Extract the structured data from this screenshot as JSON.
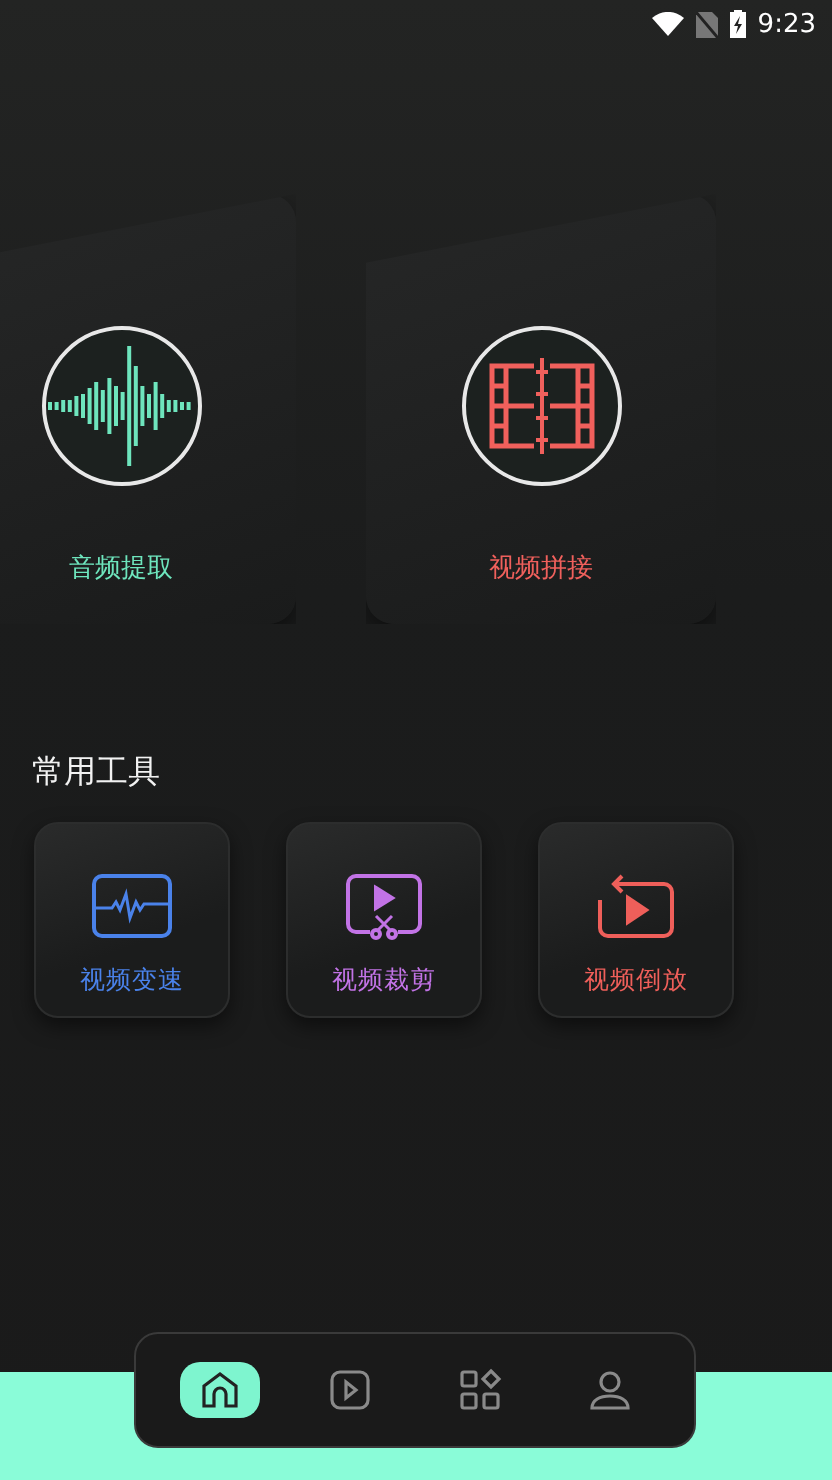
{
  "status_bar": {
    "time": "9:23"
  },
  "feature_cards": [
    {
      "kind": "audio",
      "label": "音频提取"
    },
    {
      "kind": "splice",
      "label": "视频拼接"
    }
  ],
  "section_title": "常用工具",
  "tools": [
    {
      "kind": "speed",
      "label": "视频变速"
    },
    {
      "kind": "cut",
      "label": "视频裁剪"
    },
    {
      "kind": "reverse",
      "label": "视频倒放"
    }
  ],
  "nav": [
    {
      "kind": "home",
      "selected": true
    },
    {
      "kind": "video",
      "selected": false
    },
    {
      "kind": "apps",
      "selected": false
    },
    {
      "kind": "profile",
      "selected": false
    }
  ]
}
